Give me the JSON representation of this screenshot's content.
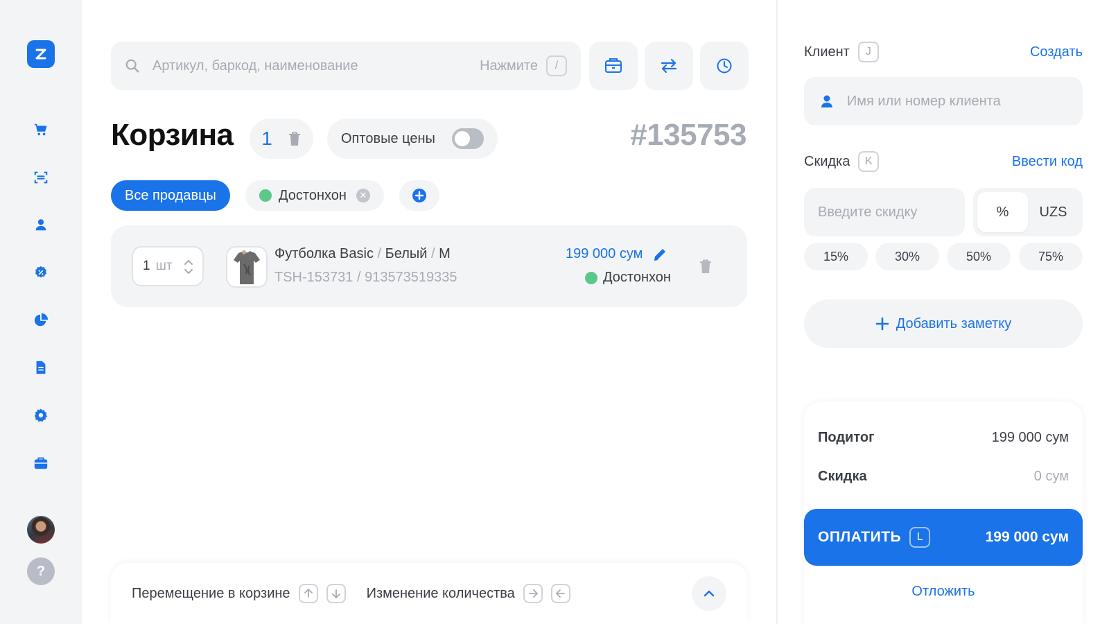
{
  "brand": {
    "logo_letter": "Z",
    "accent": "#1a73e8"
  },
  "sidebar": {
    "items": [
      {
        "icon": "cart-icon"
      },
      {
        "icon": "scanner-icon"
      },
      {
        "icon": "user-icon"
      },
      {
        "icon": "discount-badge-icon"
      },
      {
        "icon": "pie-chart-icon"
      },
      {
        "icon": "document-icon"
      },
      {
        "icon": "gear-icon"
      },
      {
        "icon": "briefcase-icon"
      }
    ],
    "help_label": "?"
  },
  "search": {
    "placeholder": "Артикул, баркод, наименование",
    "hint_text": "Нажмите",
    "hint_key": "/"
  },
  "cart": {
    "title": "Корзина",
    "count": "1",
    "wholesale_label": "Оптовые цены",
    "wholesale_enabled": false,
    "order_number": "#135753"
  },
  "filters": {
    "all_label": "Все продавцы",
    "seller_label": "Достонхон"
  },
  "item": {
    "qty": "1",
    "unit": "шт",
    "name": "Футболка Basic",
    "color": "Белый",
    "size": "M",
    "sep": "/",
    "sku": "TSH-153731 / 913573519335",
    "price": "199 000 сум",
    "seller": "Достонхон"
  },
  "hints": {
    "move_label": "Перемещение в корзине",
    "qty_label": "Изменение количества"
  },
  "client": {
    "label": "Клиент",
    "key": "J",
    "create_link": "Создать",
    "placeholder": "Имя или номер клиента"
  },
  "discount": {
    "label": "Скидка",
    "key": "K",
    "code_link": "Ввести код",
    "placeholder": "Введите скидку",
    "unit_percent": "%",
    "unit_currency": "UZS",
    "presets": [
      "15%",
      "30%",
      "50%",
      "75%"
    ]
  },
  "note": {
    "label": "Добавить заметку"
  },
  "summary": {
    "subtotal_label": "Подитог",
    "subtotal_value": "199 000 сум",
    "discount_label": "Скидка",
    "discount_value": "0 сум",
    "pay_label": "ОПЛАТИТЬ",
    "pay_key": "L",
    "pay_amount": "199 000 сум",
    "postpone_label": "Отложить"
  }
}
